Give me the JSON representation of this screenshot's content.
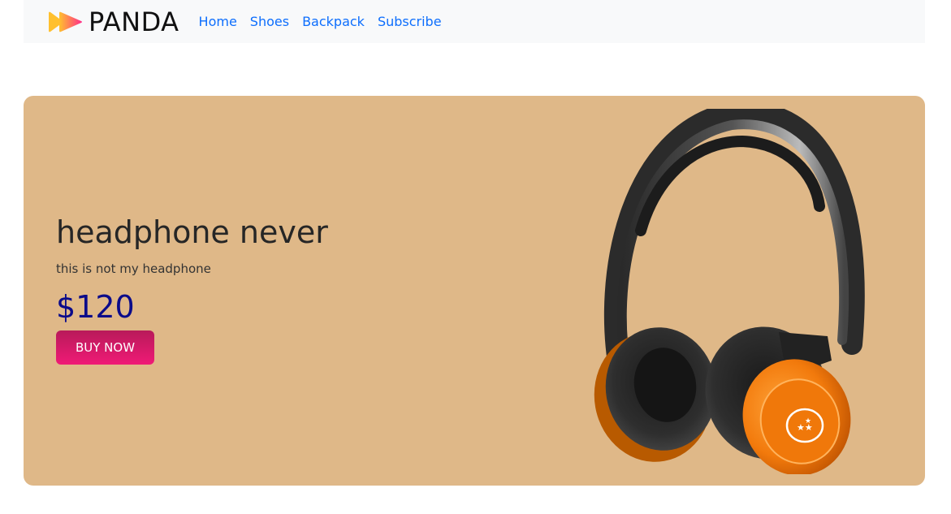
{
  "navbar": {
    "brand": "PANDA",
    "links": [
      "Home",
      "Shoes",
      "Backpack",
      "Subscribe"
    ]
  },
  "hero": {
    "title": "headphone never",
    "subtitle": "this is not my headphone",
    "price": "$120",
    "button_label": "BUY NOW",
    "product_image": "headphones-image"
  },
  "colors": {
    "navbar_bg": "#f8f9fa",
    "link": "#0d6efd",
    "hero_bg": "#dfb888",
    "price": "#0b0b8a",
    "button_gradient": [
      "#b81a5a",
      "#f01a76"
    ],
    "logo_gradient": [
      "#ffc02e",
      "#ff2d8a"
    ]
  }
}
